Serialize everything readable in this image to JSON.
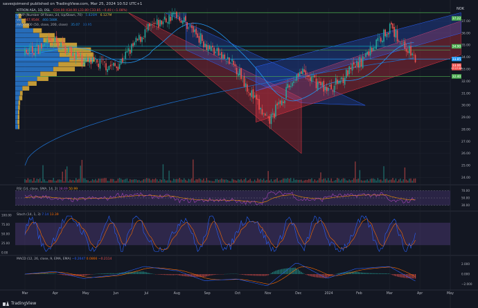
{
  "header": {
    "publisher": "savesjoimend published on TradingView.com, Mar 25, 2024 10:52 UTC+1",
    "currency": "NOK",
    "brand": "TradingView"
  },
  "legend": {
    "main": "KITRON ASA, 1D, OSL",
    "ohlc": "O34.00 H34.00 L33.80 C33.85 −0.40 (−1.08%)",
    "vrvp": "VRVP (Number Of Rows, 24, Up/Down, 70)",
    "vrvp_values": [
      "5.826M",
      "6.127M"
    ],
    "vol": "Vol",
    "vol_values": [
      "247.954K",
      "460.588K"
    ],
    "ma": "MA50/200 (50, close, 200, close)",
    "ma_values": [
      "35.07",
      "33.95"
    ]
  },
  "price_labels": {
    "a": "37.22",
    "b": "34.90",
    "c": "33.85",
    "c_time": "07:17:36",
    "d": "32.40",
    "e": "33.06"
  },
  "colors": {
    "background": "#131722",
    "up": "#26a69a",
    "down": "#ef5350",
    "channel_blue": "#2962ff",
    "channel_red": "#f23645",
    "ma50": "#2196f3",
    "ma200": "#1e6ec9",
    "vrvp_up": "#2a7bd4",
    "vrvp_down": "#e3b13a",
    "rsi_line": "#ab47bc",
    "rsi_ma": "#ff9800",
    "stoch_k": "#2962ff",
    "stoch_d": "#ff6d00",
    "macd_line": "#2962ff",
    "signal_line": "#ff6d00",
    "level_green": "#4caf50",
    "level_blue": "#2196f3",
    "level_cyan": "#00bcd4"
  },
  "indicators": {
    "rsi_label": "RSI (14, close, SMA, 14, 2)",
    "rsi_values": [
      "38.69",
      "50.99"
    ],
    "stoch_label": "Stoch (14, 1, 3)",
    "stoch_values": [
      "7.14",
      "13.39"
    ],
    "macd_label": "MACD (12, 26, close, 9, EMA, EMA)",
    "macd_values": [
      "−0.2647",
      "0.0866",
      "−0.2114"
    ]
  },
  "chart_data": {
    "type": "candlestick",
    "months": [
      "Mar",
      "Apr",
      "May",
      "Jun",
      "Jul",
      "Aug",
      "Sep",
      "Oct",
      "Nov",
      "Dec",
      "2024",
      "Feb",
      "Mar",
      "Apr",
      "May"
    ],
    "price_axis": [
      "37.00",
      "36.00",
      "35.00",
      "34.00",
      "33.00",
      "32.00",
      "31.00",
      "30.00",
      "29.00",
      "28.00",
      "27.00",
      "26.00",
      "25.00",
      "24.00"
    ],
    "price_range": [
      23.8,
      37.6
    ],
    "close_anchors": [
      [
        "Mar",
        34.3
      ],
      [
        "Apr",
        35.3
      ],
      [
        "May",
        33.6
      ],
      [
        "Jun",
        33.2
      ],
      [
        "Jul",
        36.2
      ],
      [
        "Aug",
        37.6
      ],
      [
        "Sep",
        35.0
      ],
      [
        "Oct",
        33.0
      ],
      [
        "Nov",
        28.5
      ],
      [
        "Dec",
        32.8
      ],
      [
        "2024",
        31.3
      ],
      [
        "Feb",
        33.5
      ],
      [
        "Mar",
        36.5
      ],
      [
        "Apr",
        33.85
      ]
    ],
    "rsi": {
      "axis": [
        "70.00",
        "50.00",
        "30.00"
      ],
      "range": [
        20,
        80
      ],
      "upper": 70,
      "lower": 30
    },
    "stoch": {
      "axis": [
        "100.00",
        "75.00",
        "50.00",
        "25.00",
        "0.00"
      ],
      "range": [
        0,
        100
      ],
      "upper": 80,
      "lower": 20
    },
    "macd": {
      "axis": [
        "2.000",
        "0.000",
        "−2.000"
      ],
      "range": [
        -2.6,
        2.6
      ]
    }
  }
}
